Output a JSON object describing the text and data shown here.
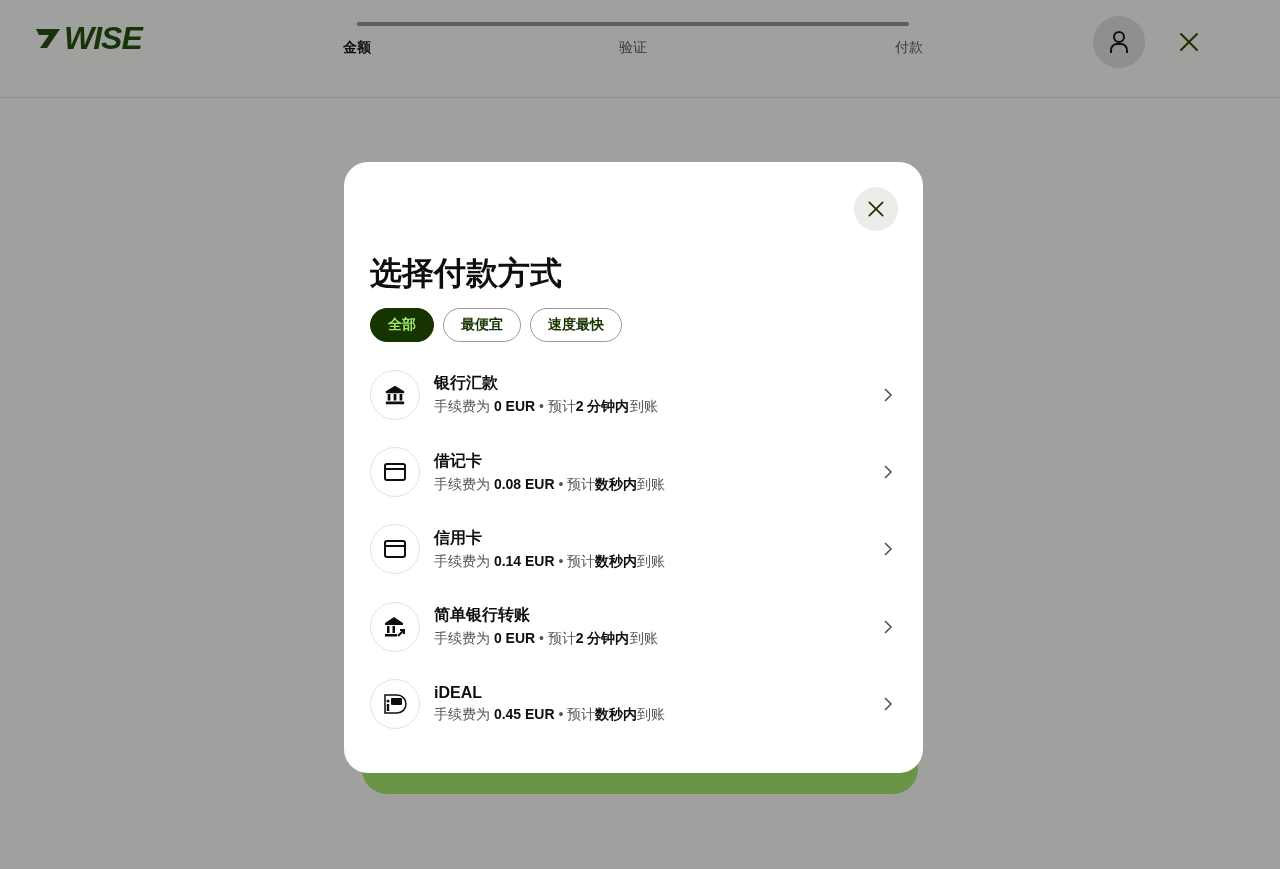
{
  "header": {
    "logo": "WISE",
    "progress": {
      "level": 1
    },
    "steps": [
      {
        "label": "金额",
        "selected": true
      },
      {
        "label": "验证",
        "selected": false
      },
      {
        "label": "付款",
        "selected": false
      }
    ]
  },
  "modal": {
    "title": "选择付款方式",
    "filters": [
      {
        "label": "全部",
        "selected": true
      },
      {
        "label": "最便宜",
        "selected": false
      },
      {
        "label": "速度最快",
        "selected": false
      }
    ],
    "methods": [
      {
        "kind": "bank",
        "name": "银行汇款",
        "detail": "手续费为 **0 EUR** • 预计**2 分钟内**到账"
      },
      {
        "kind": "card",
        "name": "借记卡",
        "detail": "手续费为 **0.08 EUR** • 预计**数秒内**到账"
      },
      {
        "kind": "card",
        "name": "信用卡",
        "detail": "手续费为 **0.14 EUR** • 预计**数秒内**到账"
      },
      {
        "kind": "bank-transfer",
        "name": "简单银行转账",
        "detail": "手续费为 **0 EUR** • 预计**2 分钟内**到账"
      },
      {
        "kind": "ideal",
        "name": "iDEAL",
        "detail": "手续费为 **0.45 EUR** • 预计**数秒内**到账"
      }
    ]
  }
}
